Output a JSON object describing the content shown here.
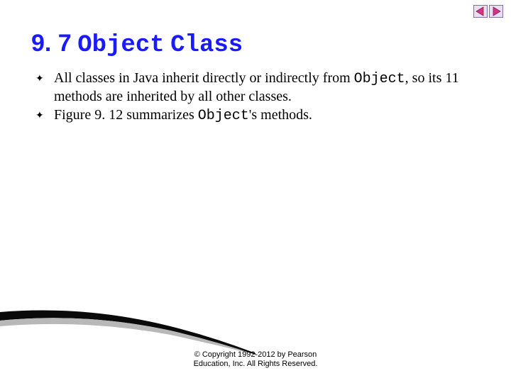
{
  "title": {
    "number": "9. 7",
    "code_word": "Object",
    "suffix_word": "Class"
  },
  "bullets": [
    {
      "pre": "All classes in Java inherit directly or indirectly from ",
      "code": "Object",
      "mid": ", so its 11 methods are inherited by all other classes."
    },
    {
      "pre": "Figure 9. 12 summarizes ",
      "code": "Object",
      "mid": "'s methods."
    }
  ],
  "copyright": {
    "line1": "© Copyright 1992-2012 by Pearson",
    "line2": "Education, Inc. All Rights Reserved."
  },
  "icons": {
    "prev": "prev-arrow-icon",
    "next": "next-arrow-icon"
  }
}
